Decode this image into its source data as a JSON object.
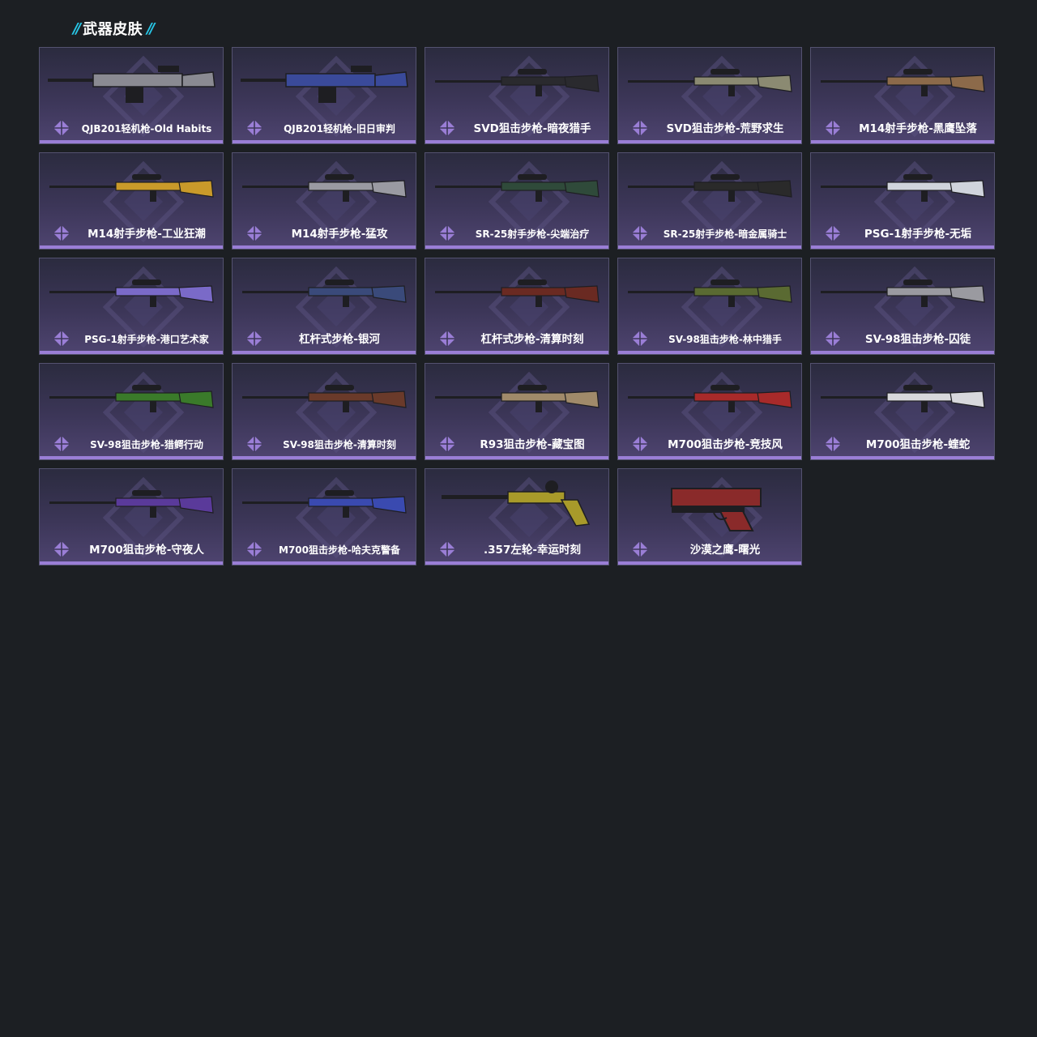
{
  "section": {
    "title": "武器皮肤"
  },
  "skins": [
    {
      "name": "QJB201轻机枪-Old Habits",
      "icon": "lmg-icon",
      "color": "#8a8a92"
    },
    {
      "name": "QJB201轻机枪-旧日审判",
      "icon": "lmg-icon",
      "color": "#3a4a9a"
    },
    {
      "name": "SVD狙击步枪-暗夜猎手",
      "icon": "sniper-rifle-icon",
      "color": "#2a2a2e"
    },
    {
      "name": "SVD狙击步枪-荒野求生",
      "icon": "sniper-rifle-icon",
      "color": "#8b8a72"
    },
    {
      "name": "M14射手步枪-黑鹰坠落",
      "icon": "marksman-rifle-icon",
      "color": "#8c6a4a"
    },
    {
      "name": "M14射手步枪-工业狂潮",
      "icon": "marksman-rifle-icon",
      "color": "#c99a2a"
    },
    {
      "name": "M14射手步枪-猛攻",
      "icon": "marksman-rifle-icon",
      "color": "#9a9aa2"
    },
    {
      "name": "SR-25射手步枪-尖端治疗",
      "icon": "marksman-rifle-icon",
      "color": "#2f4a3a"
    },
    {
      "name": "SR-25射手步枪-暗金属骑士",
      "icon": "marksman-rifle-icon",
      "color": "#2a2a2a"
    },
    {
      "name": "PSG-1射手步枪-无垢",
      "icon": "marksman-rifle-icon",
      "color": "#d0d4dc"
    },
    {
      "name": "PSG-1射手步枪-港口艺术家",
      "icon": "marksman-rifle-icon",
      "color": "#7a6ac8"
    },
    {
      "name": "杠杆式步枪-银河",
      "icon": "lever-rifle-icon",
      "color": "#3a4a7a"
    },
    {
      "name": "杠杆式步枪-清算时刻",
      "icon": "lever-rifle-icon",
      "color": "#6a2a22"
    },
    {
      "name": "SV-98狙击步枪-林中猎手",
      "icon": "sniper-rifle-icon",
      "color": "#5a6a32"
    },
    {
      "name": "SV-98狙击步枪-囚徒",
      "icon": "sniper-rifle-icon",
      "color": "#9a9aa0"
    },
    {
      "name": "SV-98狙击步枪-猎鳄行动",
      "icon": "sniper-rifle-icon",
      "color": "#3a7a2a"
    },
    {
      "name": "SV-98狙击步枪-清算时刻",
      "icon": "sniper-rifle-icon",
      "color": "#6a3a2a"
    },
    {
      "name": "R93狙击步枪-藏宝图",
      "icon": "sniper-rifle-icon",
      "color": "#a08a6a"
    },
    {
      "name": "M700狙击步枪-竞技风",
      "icon": "sniper-rifle-icon",
      "color": "#a82a2a"
    },
    {
      "name": "M700狙击步枪-蝰蛇",
      "icon": "sniper-rifle-icon",
      "color": "#d8d8dc"
    },
    {
      "name": "M700狙击步枪-守夜人",
      "icon": "sniper-rifle-icon",
      "color": "#5a3a9a"
    },
    {
      "name": "M700狙击步枪-哈夫克警备",
      "icon": "sniper-rifle-icon",
      "color": "#3a4ab0"
    },
    {
      "name": ".357左轮-幸运时刻",
      "icon": "revolver-icon",
      "color": "#a89a2a"
    },
    {
      "name": "沙漠之鹰-曙光",
      "icon": "pistol-icon",
      "color": "#8a2a2a"
    }
  ]
}
